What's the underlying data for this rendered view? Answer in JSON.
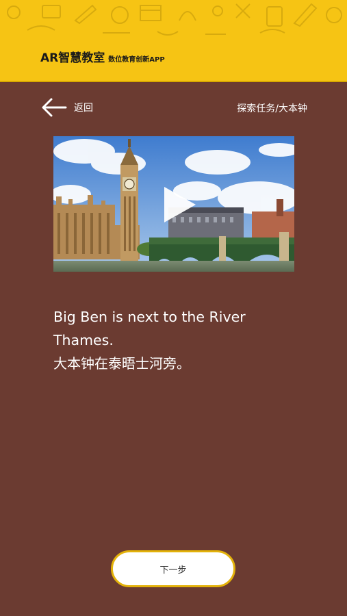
{
  "header": {
    "title": "AR智慧教室",
    "subtitle": "数位教育创新APP"
  },
  "nav": {
    "back_label": "返回",
    "breadcrumb": "探索任务/大本钟"
  },
  "video": {
    "icon": "play-icon"
  },
  "caption": {
    "english": "Big Ben is next to the River Thames.",
    "chinese": "大本钟在泰晤士河旁。"
  },
  "footer": {
    "next_label": "下一步"
  },
  "colors": {
    "background": "#6b3b31",
    "header": "#f6c414",
    "button_border": "#e3b20a"
  }
}
